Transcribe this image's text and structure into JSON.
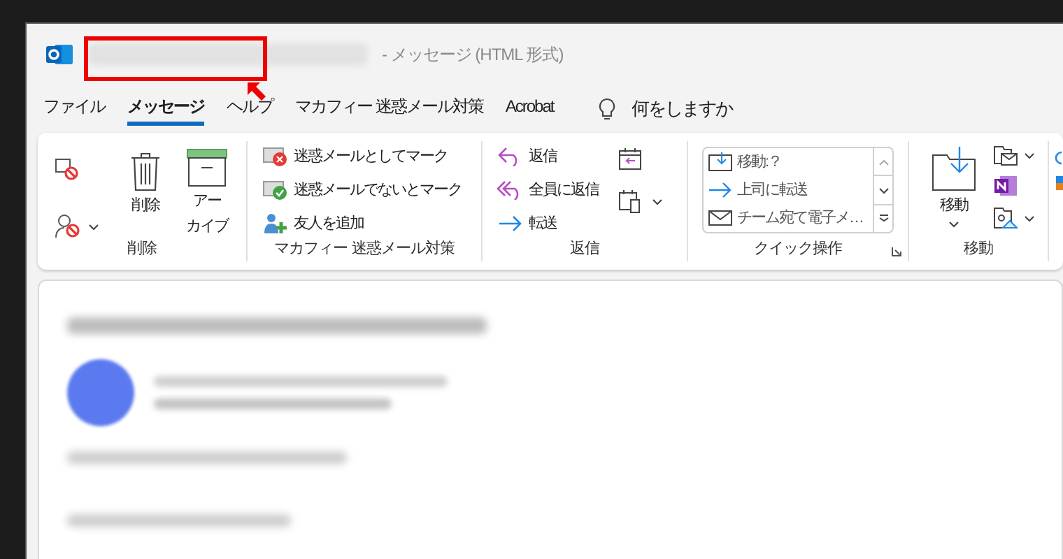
{
  "window": {
    "title_suffix": "-  メッセージ (HTML 形式)"
  },
  "tabs": [
    {
      "label": "ファイル",
      "selected": false
    },
    {
      "label": "メッセージ",
      "selected": true
    },
    {
      "label": "ヘルプ",
      "selected": false
    },
    {
      "label": "マカフィー 迷惑メール対策",
      "selected": false
    },
    {
      "label": "Acrobat",
      "selected": false
    }
  ],
  "tell_me": {
    "placeholder": "何をしますか"
  },
  "ribbon": {
    "groups": [
      {
        "label": "削除",
        "items": [
          {
            "kind": "large",
            "label": "削除"
          },
          {
            "kind": "large",
            "lines": [
              "アー",
              "カイブ"
            ]
          }
        ]
      },
      {
        "label": "マカフィー 迷惑メール対策",
        "items": [
          {
            "kind": "row",
            "label": "迷惑メールとしてマーク"
          },
          {
            "kind": "row",
            "label": "迷惑メールでないとマーク"
          },
          {
            "kind": "row",
            "label": "友人を追加"
          }
        ]
      },
      {
        "label": "返信",
        "items": [
          {
            "kind": "row",
            "label": "返信"
          },
          {
            "kind": "row",
            "label": "全員に返信"
          },
          {
            "kind": "row",
            "label": "転送"
          }
        ]
      },
      {
        "label": "クイック操作",
        "items": [
          {
            "kind": "gallery",
            "label": "移動: ?"
          },
          {
            "kind": "gallery",
            "label": "上司に転送"
          },
          {
            "kind": "gallery",
            "label": "チーム宛て電子メ…"
          }
        ]
      },
      {
        "label": "移動",
        "items": [
          {
            "kind": "large",
            "label": "移動"
          }
        ]
      }
    ]
  }
}
